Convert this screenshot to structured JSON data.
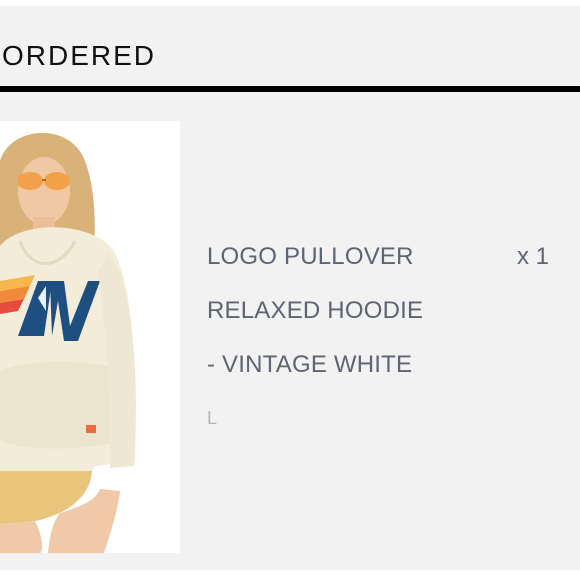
{
  "section": {
    "title": "ORDERED"
  },
  "order_item": {
    "image_icon": "product-photo",
    "name_lines": [
      "LOGO PULLOVER",
      "RELAXED HOODIE",
      "- VINTAGE WHITE"
    ],
    "quantity": "x 1",
    "size": "L"
  },
  "colors": {
    "background": "#f2f2f2",
    "divider": "#000000",
    "text_primary": "#5e6470",
    "text_muted": "#b3b6bb"
  }
}
